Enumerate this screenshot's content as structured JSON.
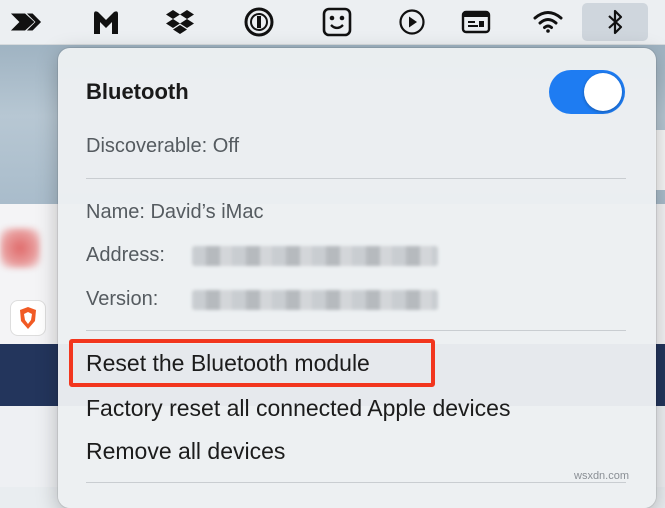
{
  "menubar": {
    "icons": [
      "arrow-chevron-icon",
      "malwarebytes-m-icon",
      "dropbox-icon",
      "onepassword-icon",
      "amphetamine-icon",
      "play-circle-icon",
      "screen-icon",
      "wifi-icon",
      "bluetooth-icon"
    ]
  },
  "menu": {
    "title": "Bluetooth",
    "toggle_on": true,
    "discoverable": "Discoverable: Off",
    "name": "Name: David’s iMac",
    "address_label": "Address:",
    "version_label": "Version:",
    "items": [
      "Reset the Bluetooth module",
      "Factory reset all connected Apple devices",
      "Remove all devices"
    ]
  },
  "colors": {
    "accent": "#1e7cf2",
    "highlight": "#f2361e",
    "menu_bg": "#eceff2"
  },
  "watermark": "wsxdn.com"
}
